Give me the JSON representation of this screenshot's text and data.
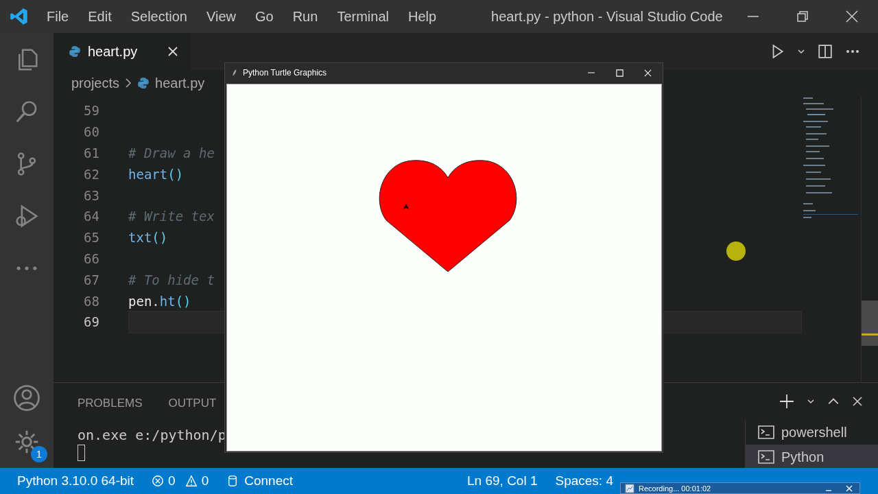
{
  "window": {
    "menu": [
      "File",
      "Edit",
      "Selection",
      "View",
      "Go",
      "Run",
      "Terminal",
      "Help"
    ],
    "title": "heart.py - python - Visual Studio Code"
  },
  "activity_bar": {
    "settings_badge": "1"
  },
  "tabs": [
    {
      "label": "heart.py",
      "selected": true
    }
  ],
  "breadcrumb": [
    "projects",
    "heart.py"
  ],
  "editor": {
    "lines": [
      {
        "number": "59",
        "current": false
      },
      {
        "number": "60",
        "current": false
      },
      {
        "number": "61",
        "current": false,
        "tokens": [
          {
            "kind": "comment",
            "text": "# Draw a he"
          }
        ]
      },
      {
        "number": "62",
        "current": false,
        "tokens": [
          {
            "kind": "func",
            "text": "heart"
          },
          {
            "kind": "paren",
            "text": "()"
          }
        ]
      },
      {
        "number": "63",
        "current": false
      },
      {
        "number": "64",
        "current": false,
        "tokens": [
          {
            "kind": "comment",
            "text": "# Write tex"
          }
        ]
      },
      {
        "number": "65",
        "current": false,
        "tokens": [
          {
            "kind": "func",
            "text": "txt"
          },
          {
            "kind": "paren",
            "text": "()"
          }
        ]
      },
      {
        "number": "66",
        "current": false
      },
      {
        "number": "67",
        "current": false,
        "tokens": [
          {
            "kind": "comment",
            "text": "# To hide t"
          }
        ]
      },
      {
        "number": "68",
        "current": false,
        "tokens": [
          {
            "kind": "name",
            "text": "pen"
          },
          {
            "kind": "plain",
            "text": "."
          },
          {
            "kind": "func",
            "text": "ht"
          },
          {
            "kind": "paren",
            "text": "()"
          }
        ]
      },
      {
        "number": "69",
        "current": true
      }
    ]
  },
  "panel": {
    "tabs": [
      {
        "label": "PROBLEMS",
        "selected": false
      },
      {
        "label": "OUTPUT",
        "selected": false
      }
    ],
    "terminal_lines": [
      "on.exe e:/python/p"
    ],
    "terminals": [
      {
        "label": "powershell",
        "selected": false
      },
      {
        "label": "Python",
        "selected": true
      }
    ]
  },
  "turtle_window": {
    "title": "Python Turtle Graphics"
  },
  "status_bar": {
    "interpreter": "Python 3.10.0 64-bit",
    "errors": "0",
    "warnings": "0",
    "connect": "Connect",
    "position": "Ln 69, Col 1",
    "spaces": "Spaces: 4"
  },
  "recording": {
    "label": "Recording... 00:01:02"
  }
}
